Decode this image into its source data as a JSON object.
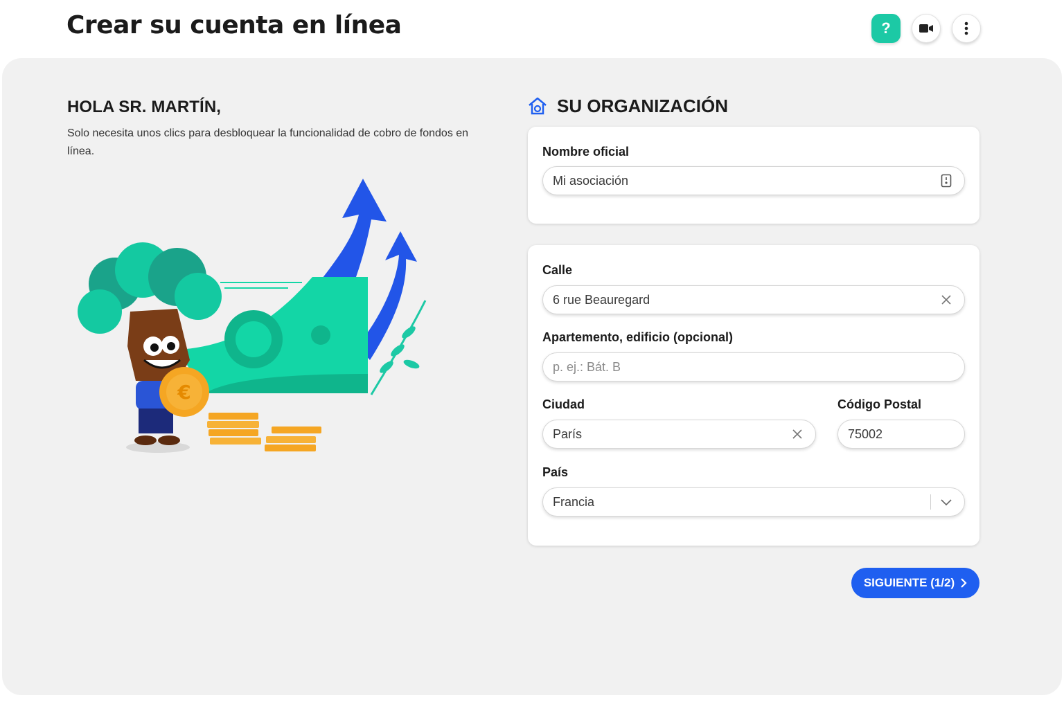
{
  "header": {
    "title": "Crear su cuenta en línea",
    "help_label": "?",
    "icons": [
      "help-icon",
      "video-camera-icon",
      "more-vertical-icon"
    ]
  },
  "intro": {
    "greeting": "HOLA SR. MARTÍN,",
    "text": "Solo necesita unos clics para desbloquear la funcionalidad de cobro de fondos en línea."
  },
  "organization": {
    "section_title": "SU ORGANIZACIÓN",
    "official_name": {
      "label": "Nombre oficial",
      "value": "Mi asociación"
    },
    "street": {
      "label": "Calle",
      "value": "6 rue Beauregard"
    },
    "apartment": {
      "label": "Apartemento, edificio (opcional)",
      "value": "",
      "placeholder": "p. ej.: Bát. B"
    },
    "city": {
      "label": "Ciudad",
      "value": "París"
    },
    "postal_code": {
      "label": "Código Postal",
      "value": "75002"
    },
    "country": {
      "label": "País",
      "value": "Francia"
    }
  },
  "actions": {
    "next_label": "SIGUIENTE (1/2)"
  },
  "colors": {
    "accent_green": "#1cc9a5",
    "primary_blue": "#1f5ff0",
    "canvas_bg": "#f1f1f1"
  }
}
